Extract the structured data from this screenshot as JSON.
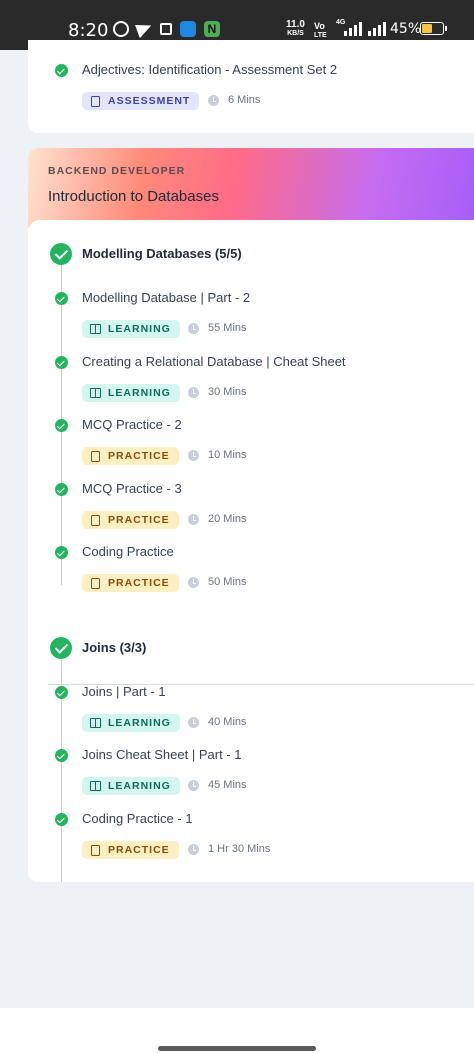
{
  "status_bar": {
    "time": "8:20",
    "speed_value": "11.0",
    "speed_unit": "KB/S",
    "volte_top": "Vo",
    "volte_bottom": "LTE",
    "network_type": "4G",
    "battery": "45%",
    "icons": [
      "whatsapp-icon",
      "telegram-icon",
      "camera-icon",
      "blue-app-icon",
      "n-app-icon"
    ]
  },
  "prev_card": {
    "item": {
      "title": "Adjectives: Identification - Assessment Set 2",
      "badge": "ASSESSMENT",
      "duration": "6 Mins"
    }
  },
  "db_card": {
    "category": "BACKEND DEVELOPER",
    "title": "Introduction to Databases",
    "sections": [
      {
        "title": "Modelling Databases (5/5)",
        "items": [
          {
            "title": "Modelling Database | Part - 2",
            "badge": "LEARNING",
            "duration": "55 Mins"
          },
          {
            "title": "Creating a Relational Database | Cheat Sheet",
            "badge": "LEARNING",
            "duration": "30 Mins"
          },
          {
            "title": "MCQ Practice - 2",
            "badge": "PRACTICE",
            "duration": "10 Mins"
          },
          {
            "title": "MCQ Practice - 3",
            "badge": "PRACTICE",
            "duration": "20 Mins"
          },
          {
            "title": "Coding Practice",
            "badge": "PRACTICE",
            "duration": "50 Mins"
          }
        ]
      },
      {
        "title": "Joins (3/3)",
        "items": [
          {
            "title": "Joins | Part - 1",
            "badge": "LEARNING",
            "duration": "40 Mins"
          },
          {
            "title": "Joins Cheat Sheet | Part - 1",
            "badge": "LEARNING",
            "duration": "45 Mins"
          },
          {
            "title": "Coding Practice - 1",
            "badge": "PRACTICE",
            "duration": "1 Hr 30 Mins"
          }
        ]
      }
    ]
  },
  "colors": {
    "complete_green": "#22b55f",
    "learning_bg": "#d3f6ee",
    "practice_bg": "#fcefc2",
    "assessment_bg": "#e3e6fb"
  }
}
